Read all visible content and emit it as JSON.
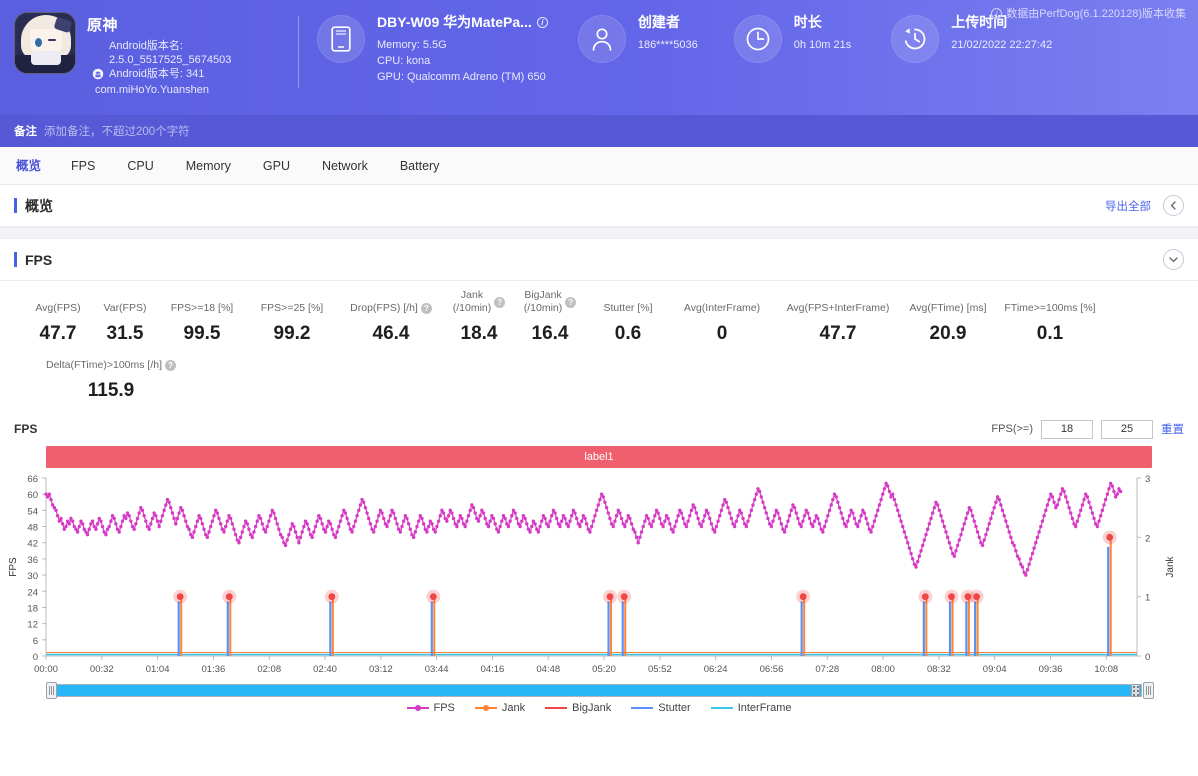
{
  "header": {
    "collect_note": "数据由PerfDog(6.1.220128)版本收集",
    "app": {
      "name": "原神",
      "version_label": "Android版本名:",
      "version_value": "2.5.0_5517525_5674503",
      "build_label": "Android版本号: 341",
      "package": "com.miHoYo.Yuanshen"
    },
    "device": {
      "title": "DBY-W09 华为MatePa...",
      "lines": [
        "Memory: 5.5G",
        "CPU: kona",
        "GPU: Qualcomm Adreno (TM) 650"
      ]
    },
    "creator": {
      "title": "创建者",
      "lines": [
        "186****5036"
      ]
    },
    "duration": {
      "title": "时长",
      "lines": [
        "0h 10m 21s"
      ]
    },
    "upload": {
      "title": "上传时间",
      "lines": [
        "21/02/2022 22:27:42"
      ]
    },
    "remark": {
      "label": "备注",
      "placeholder": "添加备注，不超过200个字符"
    }
  },
  "tabs": [
    {
      "label": "概览",
      "active": true
    },
    {
      "label": "FPS",
      "active": false
    },
    {
      "label": "CPU",
      "active": false
    },
    {
      "label": "Memory",
      "active": false
    },
    {
      "label": "GPU",
      "active": false
    },
    {
      "label": "Network",
      "active": false
    },
    {
      "label": "Battery",
      "active": false
    }
  ],
  "overview_section": {
    "title": "概览",
    "export_label": "导出全部"
  },
  "fps_section": {
    "title": "FPS"
  },
  "metrics": {
    "row1": [
      {
        "label": "Avg(FPS)",
        "value": "47.7",
        "help": false
      },
      {
        "label": "Var(FPS)",
        "value": "31.5",
        "help": false
      },
      {
        "label": "FPS>=18 [%]",
        "value": "99.5",
        "help": false
      },
      {
        "label": "FPS>=25 [%]",
        "value": "99.2",
        "help": false
      },
      {
        "label": "Drop(FPS) [/h]",
        "value": "46.4",
        "help": true
      },
      {
        "label": "Jank\n(/10min)",
        "value": "18.4",
        "help": true
      },
      {
        "label": "BigJank\n(/10min)",
        "value": "16.4",
        "help": true
      },
      {
        "label": "Stutter [%]",
        "value": "0.6",
        "help": false
      },
      {
        "label": "Avg(InterFrame)",
        "value": "0",
        "help": false
      },
      {
        "label": "Avg(FPS+InterFrame)",
        "value": "47.7",
        "help": false
      },
      {
        "label": "Avg(FTime) [ms]",
        "value": "20.9",
        "help": false
      },
      {
        "label": "FTime>=100ms [%]",
        "value": "0.1",
        "help": false
      }
    ],
    "row2": [
      {
        "label": "Delta(FTime)>100ms [/h]",
        "value": "115.9",
        "help": true
      }
    ]
  },
  "chart_controls": {
    "chart_name": "FPS",
    "fps_ge_label": "FPS(>=)",
    "threshold1": "18",
    "threshold2": "25",
    "reset_label": "重置",
    "band_label": "label1"
  },
  "chart_data": {
    "type": "line",
    "title": "FPS",
    "xlabel": "",
    "ylabel": "FPS",
    "y2label": "Jank",
    "ylim": [
      0,
      66
    ],
    "y2lim": [
      0,
      3
    ],
    "yticks": [
      0,
      6,
      12,
      18,
      24,
      30,
      36,
      42,
      48,
      54,
      60,
      66
    ],
    "y2ticks": [
      0,
      1,
      2,
      3
    ],
    "grid": false,
    "xticks": [
      "00:00",
      "00:32",
      "01:04",
      "01:36",
      "02:08",
      "02:40",
      "03:12",
      "03:44",
      "04:16",
      "04:48",
      "05:20",
      "05:52",
      "06:24",
      "06:56",
      "07:28",
      "08:00",
      "08:32",
      "09:04",
      "09:36",
      "10:08"
    ],
    "x_range_seconds": [
      0,
      621
    ],
    "legend_position": "bottom",
    "series": [
      {
        "name": "FPS",
        "color": "#d63ac4",
        "axis": "left",
        "values": [
          60,
          59,
          60,
          58,
          56,
          55,
          54,
          52,
          50,
          51,
          49,
          47,
          48,
          50,
          49,
          51,
          50,
          48,
          47,
          46,
          48,
          50,
          49,
          47,
          46,
          45,
          47,
          49,
          50,
          48,
          47,
          49,
          51,
          50,
          48,
          46,
          45,
          47,
          48,
          50,
          52,
          51,
          49,
          47,
          46,
          48,
          50,
          52,
          51,
          53,
          52,
          50,
          48,
          47,
          49,
          51,
          53,
          55,
          54,
          52,
          50,
          48,
          47,
          49,
          51,
          53,
          52,
          50,
          48,
          50,
          52,
          54,
          56,
          58,
          57,
          55,
          53,
          51,
          49,
          51,
          53,
          55,
          54,
          52,
          50,
          48,
          47,
          45,
          44,
          46,
          48,
          50,
          52,
          51,
          49,
          47,
          45,
          44,
          46,
          48,
          50,
          52,
          54,
          53,
          51,
          49,
          47,
          46,
          48,
          50,
          52,
          51,
          49,
          47,
          45,
          43,
          42,
          44,
          46,
          48,
          50,
          49,
          47,
          45,
          44,
          46,
          48,
          50,
          52,
          51,
          49,
          47,
          46,
          48,
          50,
          52,
          54,
          53,
          51,
          49,
          47,
          45,
          44,
          42,
          41,
          43,
          45,
          47,
          49,
          48,
          46,
          44,
          42,
          44,
          46,
          48,
          50,
          49,
          47,
          45,
          44,
          46,
          48,
          50,
          52,
          51,
          49,
          47,
          46,
          48,
          50,
          49,
          47,
          45,
          44,
          46,
          48,
          50,
          52,
          54,
          53,
          51,
          49,
          47,
          46,
          48,
          50,
          52,
          54,
          56,
          58,
          57,
          55,
          53,
          51,
          49,
          47,
          46,
          48,
          50,
          52,
          54,
          53,
          51,
          49,
          48,
          50,
          52,
          54,
          53,
          51,
          49,
          47,
          46,
          48,
          50,
          52,
          51,
          49,
          47,
          45,
          44,
          46,
          48,
          50,
          52,
          51,
          49,
          47,
          46,
          48,
          50,
          49,
          47,
          46,
          48,
          50,
          52,
          54,
          53,
          51,
          50,
          52,
          54,
          53,
          51,
          49,
          48,
          50,
          52,
          51,
          49,
          48,
          50,
          52,
          54,
          56,
          55,
          53,
          51,
          50,
          52,
          54,
          53,
          51,
          49,
          48,
          50,
          52,
          51,
          49,
          47,
          46,
          48,
          50,
          52,
          51,
          49,
          48,
          50,
          52,
          54,
          53,
          51,
          49,
          48,
          50,
          52,
          51,
          49,
          47,
          46,
          48,
          50,
          49,
          47,
          46,
          48,
          50,
          52,
          51,
          49,
          48,
          50,
          52,
          54,
          53,
          51,
          49,
          48,
          50,
          52,
          51,
          49,
          48,
          50,
          52,
          54,
          53,
          51,
          49,
          48,
          50,
          52,
          51,
          49,
          47,
          46,
          48,
          50,
          52,
          54,
          56,
          58,
          60,
          59,
          57,
          55,
          53,
          51,
          49,
          48,
          50,
          52,
          54,
          53,
          51,
          49,
          48,
          50,
          52,
          51,
          49,
          47,
          46,
          44,
          42,
          44,
          46,
          48,
          50,
          52,
          51,
          49,
          48,
          50,
          52,
          54,
          53,
          51,
          49,
          48,
          50,
          52,
          51,
          49,
          47,
          46,
          48,
          50,
          52,
          54,
          53,
          51,
          49,
          48,
          50,
          52,
          54,
          56,
          55,
          53,
          51,
          49,
          48,
          50,
          52,
          54,
          53,
          51,
          49,
          47,
          46,
          48,
          50,
          52,
          54,
          56,
          58,
          57,
          55,
          53,
          51,
          49,
          48,
          50,
          52,
          54,
          53,
          51,
          49,
          48,
          50,
          52,
          54,
          56,
          58,
          60,
          62,
          61,
          59,
          57,
          55,
          53,
          51,
          49,
          48,
          50,
          52,
          54,
          53,
          51,
          49,
          47,
          46,
          48,
          50,
          52,
          54,
          56,
          55,
          53,
          51,
          49,
          48,
          50,
          52,
          54,
          53,
          51,
          49,
          48,
          50,
          52,
          51,
          49,
          47,
          46,
          48,
          50,
          52,
          54,
          56,
          58,
          60,
          59,
          57,
          55,
          53,
          51,
          49,
          48,
          50,
          52,
          54,
          53,
          51,
          49,
          48,
          50,
          52,
          54,
          53,
          51,
          49,
          47,
          46,
          48,
          50,
          52,
          54,
          56,
          58,
          60,
          62,
          64,
          63,
          61,
          59,
          60,
          58,
          56,
          54,
          52,
          50,
          48,
          46,
          44,
          42,
          40,
          38,
          36,
          34,
          33,
          35,
          37,
          39,
          41,
          43,
          45,
          47,
          49,
          51,
          53,
          55,
          57,
          56,
          54,
          52,
          50,
          48,
          46,
          44,
          42,
          40,
          38,
          37,
          39,
          41,
          43,
          45,
          47,
          49,
          51,
          53,
          55,
          54,
          52,
          50,
          48,
          46,
          44,
          42,
          41,
          43,
          45,
          47,
          49,
          51,
          53,
          55,
          57,
          59,
          58,
          56,
          54,
          52,
          50,
          48,
          46,
          44,
          42,
          41,
          39,
          37,
          36,
          34,
          33,
          31,
          30,
          32,
          34,
          36,
          38,
          40,
          42,
          44,
          46,
          48,
          50,
          52,
          54,
          56,
          58,
          60,
          59,
          57,
          55,
          56,
          58,
          60,
          62,
          61,
          59,
          57,
          55,
          53,
          51,
          49,
          48,
          50,
          52,
          54,
          56,
          58,
          60,
          59,
          57,
          55,
          53,
          51,
          49,
          48,
          50,
          52,
          54,
          56,
          58,
          60,
          62,
          64,
          63,
          61,
          59,
          60,
          62,
          61
        ]
      },
      {
        "name": "Jank",
        "color": "#ff8533",
        "axis": "right"
      },
      {
        "name": "BigJank",
        "color": "#f04646",
        "axis": "right"
      },
      {
        "name": "Stutter",
        "color": "#5b8ff9",
        "axis": "right"
      },
      {
        "name": "InterFrame",
        "color": "#35c7f0",
        "axis": "right"
      }
    ],
    "jank_events": [
      {
        "time": "01:16",
        "x_frac": 0.123,
        "height": 1,
        "type": "jank"
      },
      {
        "time": "01:36",
        "x_frac": 0.168,
        "height": 1,
        "type": "jank"
      },
      {
        "time": "02:36",
        "x_frac": 0.262,
        "height": 1,
        "type": "jank"
      },
      {
        "time": "03:32",
        "x_frac": 0.355,
        "height": 1,
        "type": "jank"
      },
      {
        "time": "05:04",
        "x_frac": 0.517,
        "height": 1,
        "type": "jank"
      },
      {
        "time": "05:12",
        "x_frac": 0.53,
        "height": 1,
        "type": "jank"
      },
      {
        "time": "06:52",
        "x_frac": 0.694,
        "height": 1,
        "type": "jank"
      },
      {
        "time": "08:00",
        "x_frac": 0.806,
        "height": 1,
        "type": "jank"
      },
      {
        "time": "08:28",
        "x_frac": 0.83,
        "height": 1,
        "type": "jank"
      },
      {
        "time": "08:32",
        "x_frac": 0.845,
        "height": 1,
        "type": "jank"
      },
      {
        "time": "08:36",
        "x_frac": 0.853,
        "height": 1,
        "type": "jank"
      },
      {
        "time": "10:04",
        "x_frac": 0.975,
        "height": 2,
        "type": "bigjank"
      }
    ]
  },
  "legend": [
    {
      "label": "FPS",
      "color": "#d63ac4",
      "marker": true
    },
    {
      "label": "Jank",
      "color": "#ff8533",
      "marker": true
    },
    {
      "label": "BigJank",
      "color": "#f04646",
      "marker": false
    },
    {
      "label": "Stutter",
      "color": "#5b8ff9",
      "marker": false
    },
    {
      "label": "InterFrame",
      "color": "#35c7f0",
      "marker": false
    }
  ]
}
